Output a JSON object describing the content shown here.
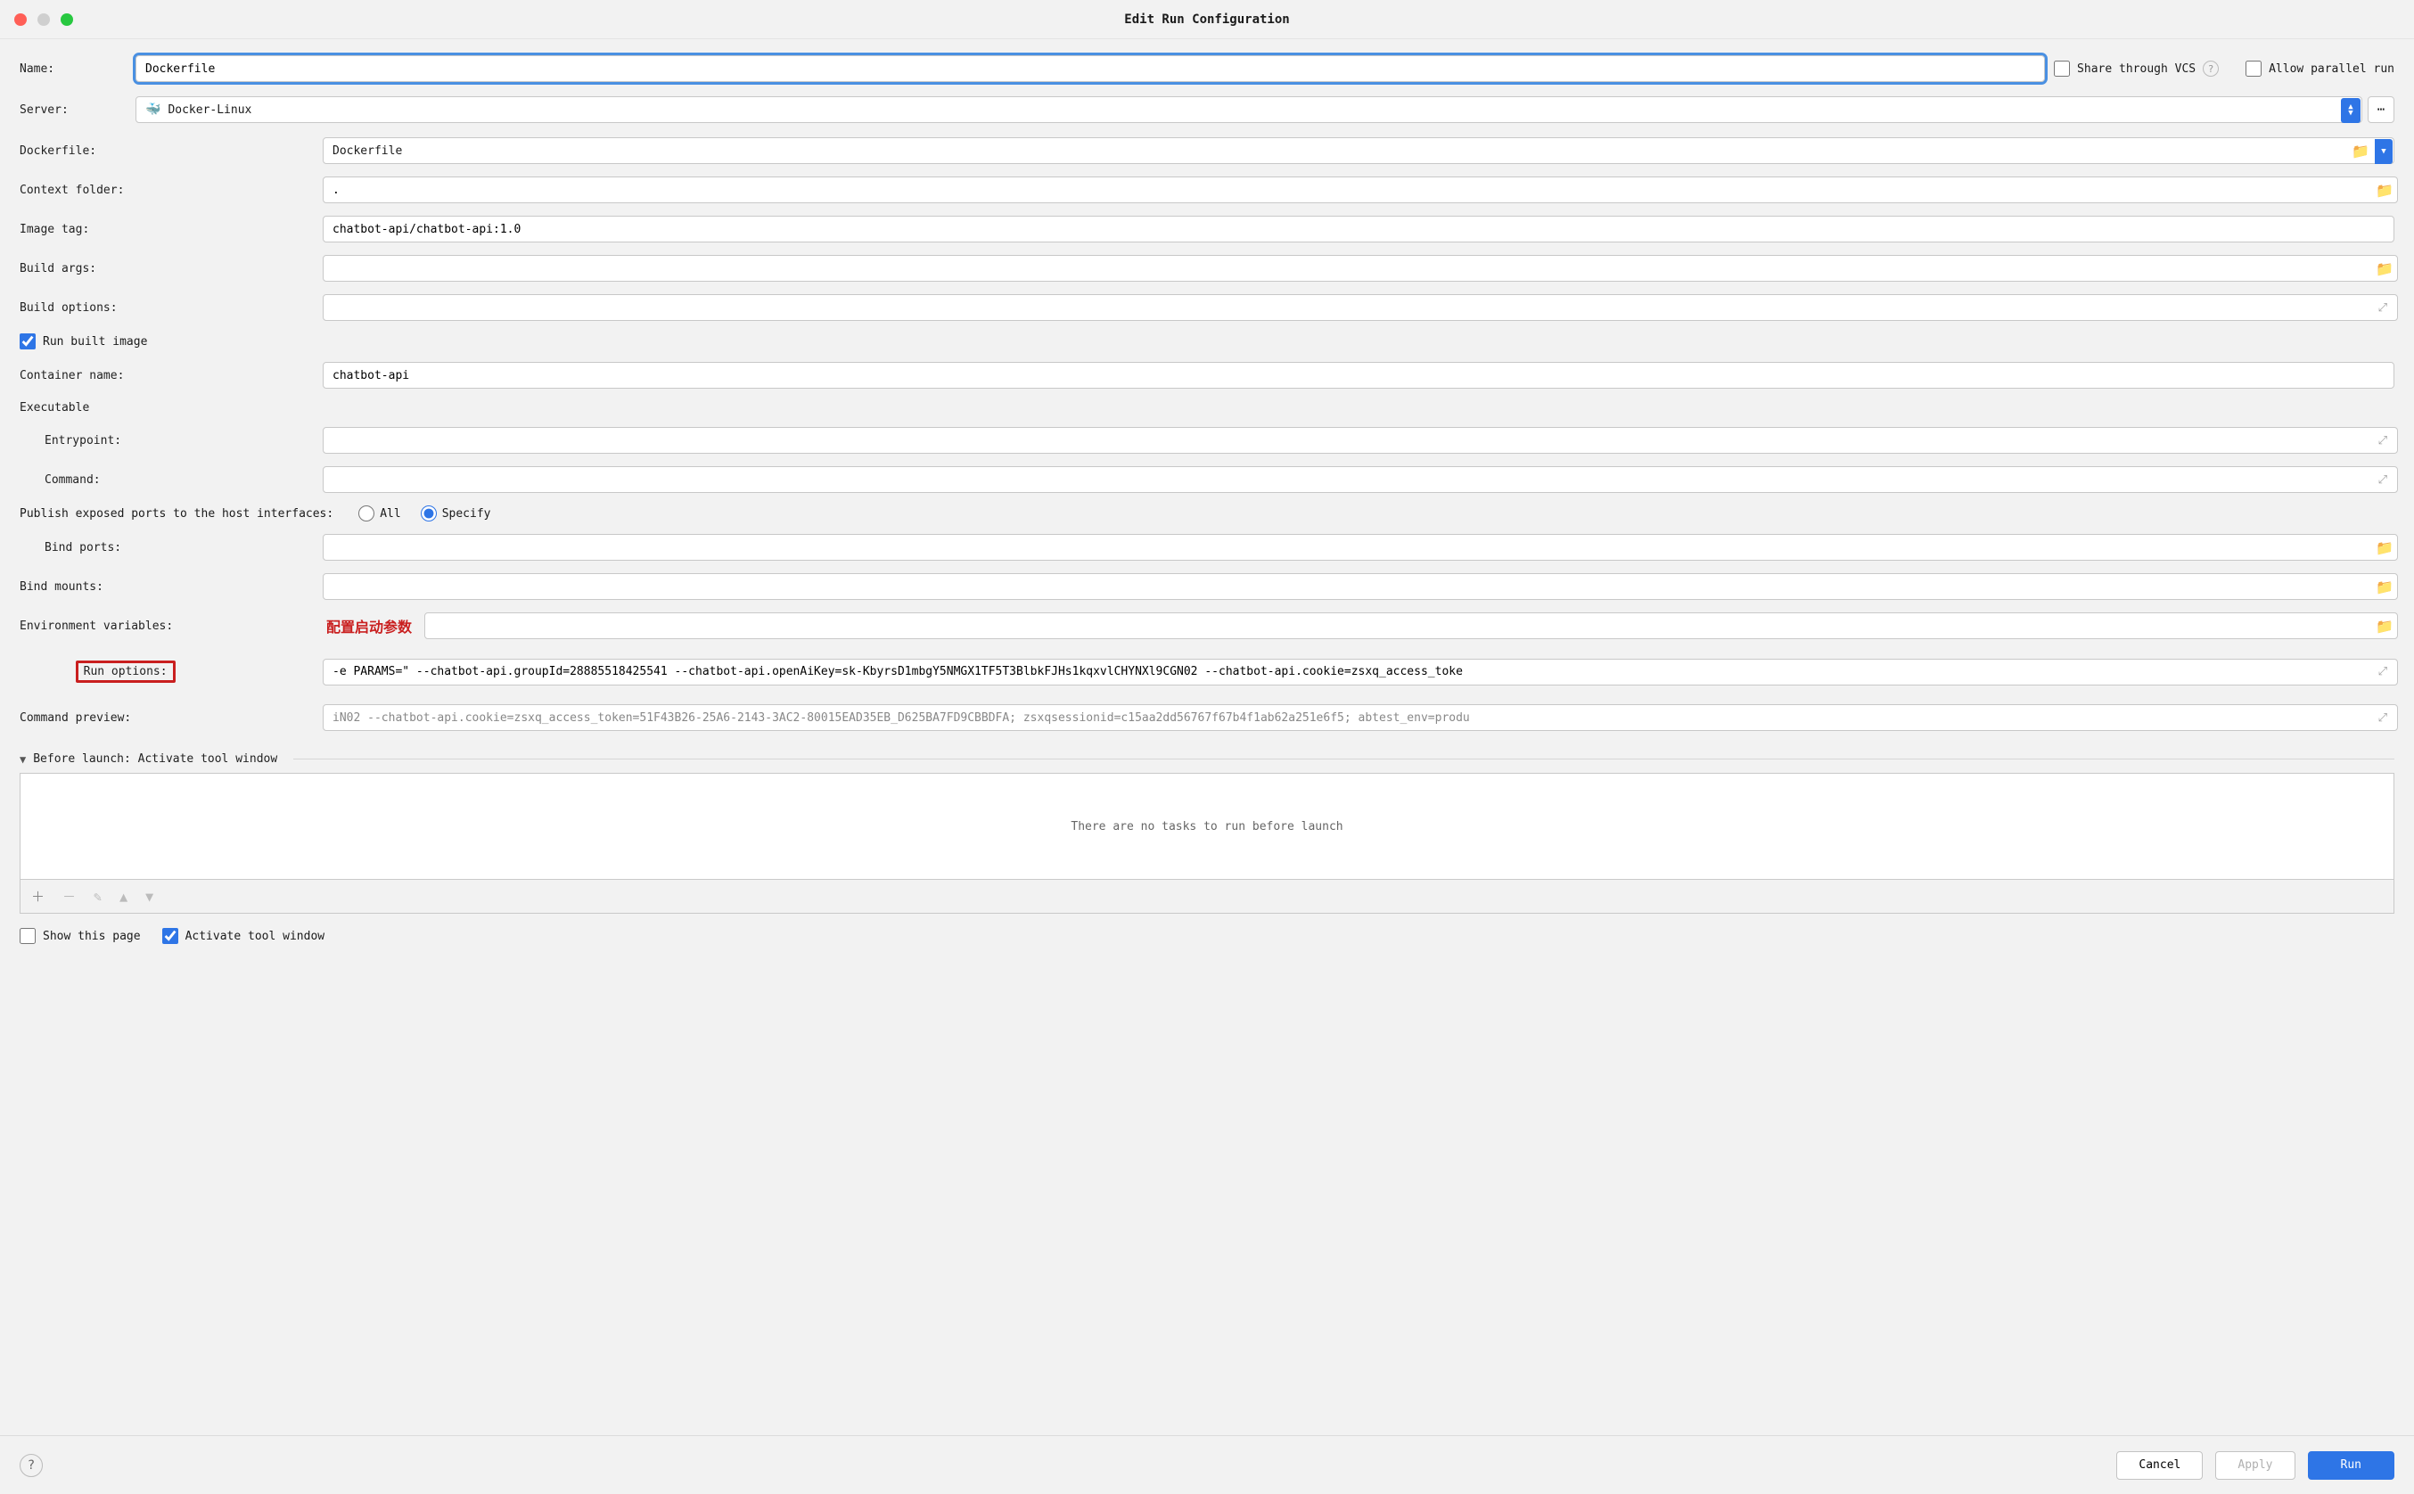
{
  "title": "Edit Run Configuration",
  "name": {
    "label": "Name:",
    "value": "Dockerfile"
  },
  "share_vcs": "Share through VCS",
  "allow_parallel": "Allow parallel run",
  "server": {
    "label": "Server:",
    "value": "Docker-Linux"
  },
  "fields": {
    "dockerfile": {
      "label": "Dockerfile:",
      "value": "Dockerfile"
    },
    "context_folder": {
      "label": "Context folder:",
      "value": "."
    },
    "image_tag": {
      "label": "Image tag:",
      "value": "chatbot-api/chatbot-api:1.0"
    },
    "build_args": {
      "label": "Build args:",
      "value": ""
    },
    "build_options": {
      "label": "Build options:",
      "value": ""
    },
    "run_built_image": "Run built image",
    "container_name": {
      "label": "Container name:",
      "value": "chatbot-api"
    },
    "executable_head": "Executable",
    "entrypoint": {
      "label": "Entrypoint:",
      "value": ""
    },
    "command": {
      "label": "Command:",
      "value": ""
    },
    "publish_ports_label": "Publish exposed ports to the host interfaces:",
    "ports_all": "All",
    "ports_specify": "Specify",
    "bind_ports": {
      "label": "Bind ports:",
      "value": ""
    },
    "bind_mounts": {
      "label": "Bind mounts:",
      "value": ""
    },
    "env_vars": {
      "label": "Environment variables:",
      "annotation": "配置启动参数"
    },
    "run_options": {
      "label": "Run options:",
      "value": "-e PARAMS=\" --chatbot-api.groupId=28885518425541 --chatbot-api.openAiKey=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 --chatbot-api.cookie=zsxq_access_toke"
    },
    "command_preview": {
      "label": "Command preview:",
      "value": "iN02 --chatbot-api.cookie=zsxq_access_token=51F43B26-25A6-2143-3AC2-80015EAD35EB_D625BA7FD9CBBDFA; zsxqsessionid=c15aa2dd56767f67b4f1ab62a251e6f5; abtest_env=produ"
    }
  },
  "before_launch": {
    "head": "Before launch: Activate tool window",
    "empty": "There are no tasks to run before launch"
  },
  "show_this_page": "Show this page",
  "activate_tool_window": "Activate tool window",
  "buttons": {
    "cancel": "Cancel",
    "apply": "Apply",
    "run": "Run"
  }
}
